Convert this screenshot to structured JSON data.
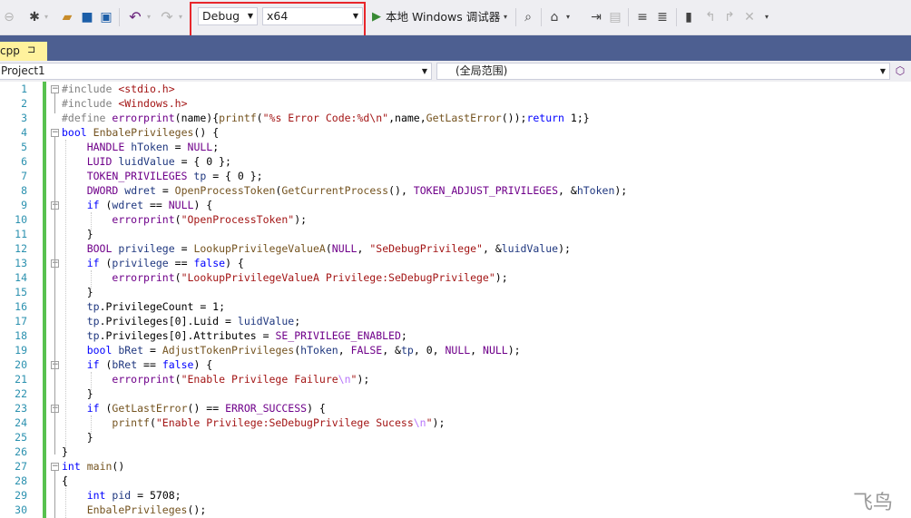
{
  "toolbar": {
    "config": "Debug",
    "platform": "x64",
    "debugger_label": "本地 Windows 调试器",
    "icons": [
      "back-icon",
      "forward-icon",
      "new-project-icon",
      "open-folder-icon",
      "save-icon",
      "save-all-icon",
      "undo-icon",
      "redo-icon",
      "play-icon",
      "find-icon",
      "home-icon",
      "step-icon",
      "list-icon",
      "indent-icon",
      "outdent-icon",
      "comment-icon",
      "uncomment-icon",
      "bookmark-icon",
      "prev-bookmark-icon",
      "next-bookmark-icon",
      "clear-bookmark-icon",
      "overflow-icon"
    ]
  },
  "tabs": [
    {
      "label": "cpp",
      "pin": "⊐"
    }
  ],
  "navbar": {
    "project": "Project1",
    "scope": "(全局范围)"
  },
  "editor": {
    "line_numbers": [
      "1",
      "2",
      "3",
      "4",
      "5",
      "6",
      "7",
      "8",
      "9",
      "10",
      "11",
      "12",
      "13",
      "14",
      "15",
      "16",
      "17",
      "18",
      "19",
      "20",
      "21",
      "22",
      "23",
      "24",
      "25",
      "26",
      "27",
      "28",
      "29",
      "30"
    ]
  },
  "watermark": "飞鸟",
  "colors": {
    "accent_red": "#e8262b",
    "tab_yellow": "#fff29d",
    "tabstrip_blue": "#4d5f91",
    "change_green": "#57c14f"
  }
}
